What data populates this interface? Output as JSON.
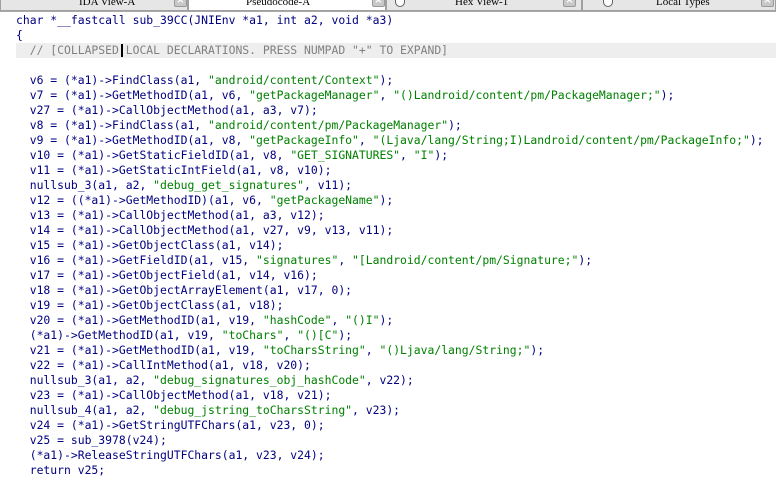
{
  "tabs": [
    {
      "label": "IDA View-A",
      "active": false,
      "icon": null
    },
    {
      "label": "Pseudocode-A",
      "active": true,
      "icon": null
    },
    {
      "label": "Hex View-1",
      "active": false,
      "icon": "hex-icon"
    },
    {
      "label": "Local Types",
      "active": false,
      "icon": "types-icon"
    }
  ],
  "close_glyph": "×",
  "code": {
    "lines": [
      "char *__fastcall sub_39CC(JNIEnv *a1, int a2, void *a3)",
      "{",
      "  // [COLLAPSED LOCAL DECLARATIONS. PRESS NUMPAD \"+\" TO EXPAND]",
      "",
      "  v6 = (*a1)->FindClass(a1, \"android/content/Context\");",
      "  v7 = (*a1)->GetMethodID(a1, v6, \"getPackageManager\", \"()Landroid/content/pm/PackageManager;\");",
      "  v27 = (*a1)->CallObjectMethod(a1, a3, v7);",
      "  v8 = (*a1)->FindClass(a1, \"android/content/pm/PackageManager\");",
      "  v9 = (*a1)->GetMethodID(a1, v8, \"getPackageInfo\", \"(Ljava/lang/String;I)Landroid/content/pm/PackageInfo;\");",
      "  v10 = (*a1)->GetStaticFieldID(a1, v8, \"GET_SIGNATURES\", \"I\");",
      "  v11 = (*a1)->GetStaticIntField(a1, v8, v10);",
      "  nullsub_3(a1, a2, \"debug_get_signatures\", v11);",
      "  v12 = ((*a1)->GetMethodID)(a1, v6, \"getPackageName\");",
      "  v13 = (*a1)->CallObjectMethod(a1, a3, v12);",
      "  v14 = (*a1)->CallObjectMethod(a1, v27, v9, v13, v11);",
      "  v15 = (*a1)->GetObjectClass(a1, v14);",
      "  v16 = (*a1)->GetFieldID(a1, v15, \"signatures\", \"[Landroid/content/pm/Signature;\");",
      "  v17 = (*a1)->GetObjectField(a1, v14, v16);",
      "  v18 = (*a1)->GetObjectArrayElement(a1, v17, 0);",
      "  v19 = (*a1)->GetObjectClass(a1, v18);",
      "  v20 = (*a1)->GetMethodID(a1, v19, \"hashCode\", \"()I\");",
      "  (*a1)->GetMethodID(a1, v19, \"toChars\", \"()[C\");",
      "  v21 = (*a1)->GetMethodID(a1, v19, \"toCharsString\", \"()Ljava/lang/String;\");",
      "  v22 = (*a1)->CallIntMethod(a1, v18, v20);",
      "  nullsub_3(a1, a2, \"debug_signatures_obj_hashCode\", v22);",
      "  v23 = (*a1)->CallObjectMethod(a1, v18, v21);",
      "  nullsub_4(a1, a2, \"debug_jstring_toCharsString\", v23);",
      "  v24 = (*a1)->GetStringUTFChars(a1, v23, 0);",
      "  v25 = sub_3978(v24);",
      "  (*a1)->ReleaseStringUTFChars(a1, v23, v24);",
      "  return v25;"
    ]
  },
  "colors": {
    "text": "#000080",
    "string": "#008000",
    "comment": "#808080",
    "tab_bar": "#dcdcdc",
    "background": "#ffffff"
  }
}
